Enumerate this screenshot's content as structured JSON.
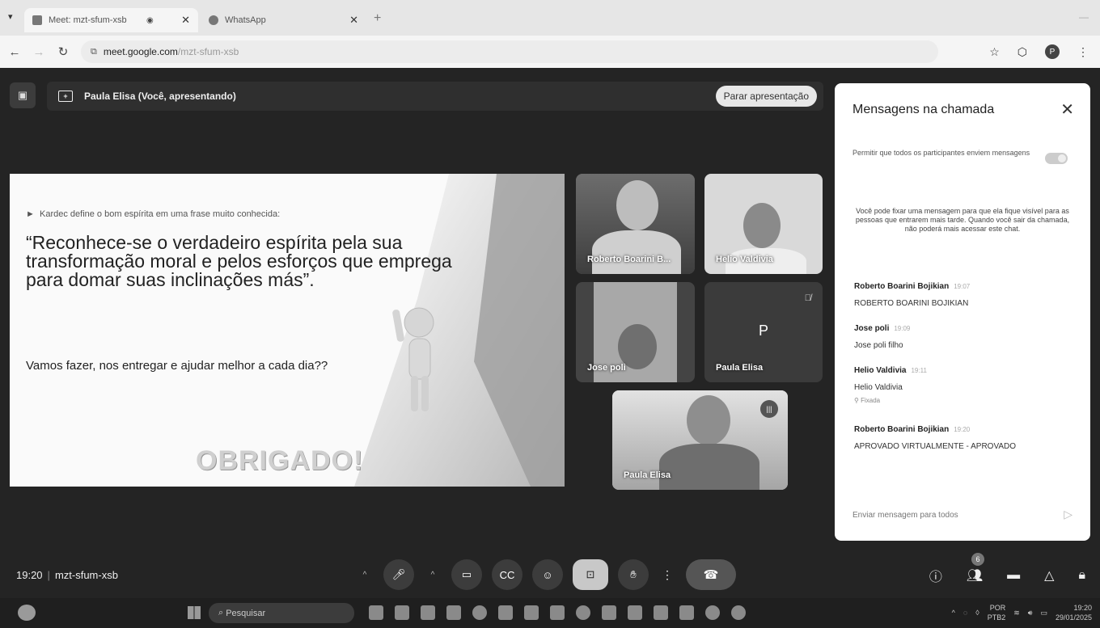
{
  "browser": {
    "tabs": [
      {
        "title": "Meet: mzt-sfum-xsb",
        "active": true
      },
      {
        "title": "WhatsApp",
        "active": false
      }
    ],
    "url_host": "meet.google.com",
    "url_path": "/mzt-sfum-xsb",
    "profile_initial": "P"
  },
  "presenting": {
    "label": "Paula Elisa (Você, apresentando)",
    "stop_button": "Parar apresentação"
  },
  "slide": {
    "bullet": "Kardec define o bom espírita em uma frase muito conhecida:",
    "quote": "“Reconhece-se o verdadeiro espírita pela sua transformação moral e pelos esforços que emprega para domar suas inclinações más”.",
    "question": "Vamos fazer, nos entregar e ajudar melhor a cada dia??",
    "thanks": "OBRIGADO!"
  },
  "participants": [
    {
      "name": "Roberto Boarini B..."
    },
    {
      "name": "Helio Valdivia"
    },
    {
      "name": "Jose poli"
    },
    {
      "name": "Paula Elisa",
      "letter": "P",
      "muted": true
    },
    {
      "name": "Paula Elisa"
    }
  ],
  "chat": {
    "title": "Mensagens na chamada",
    "permission_text": "Permitir que todos os participantes enviem mensagens",
    "info_text": "Você pode fixar uma mensagem para que ela fique visível para as pessoas que entrarem mais tarde. Quando você sair da chamada, não poderá mais acessar este chat.",
    "messages": [
      {
        "sender": "Roberto Boarini Bojikian",
        "time": "19:07",
        "text": "ROBERTO BOARINI BOJIKIAN"
      },
      {
        "sender": "Jose poli",
        "time": "19:09",
        "text": "Jose poli filho"
      },
      {
        "sender": "Helio Valdivia",
        "time": "19:11",
        "text": "Helio Valdivia",
        "pinned": "Fixada"
      },
      {
        "sender": "Roberto Boarini Bojikian",
        "time": "19:20",
        "text": "APROVADO VIRTUALMENTE - APROVADO"
      }
    ],
    "input_placeholder": "Enviar mensagem para todos"
  },
  "meeting": {
    "time": "19:20",
    "code": "mzt-sfum-xsb",
    "participant_count": "6"
  },
  "taskbar": {
    "search_placeholder": "Pesquisar",
    "lang_top": "POR",
    "lang_bottom": "PTB2",
    "clock_time": "19:20",
    "clock_date": "29/01/2025"
  }
}
